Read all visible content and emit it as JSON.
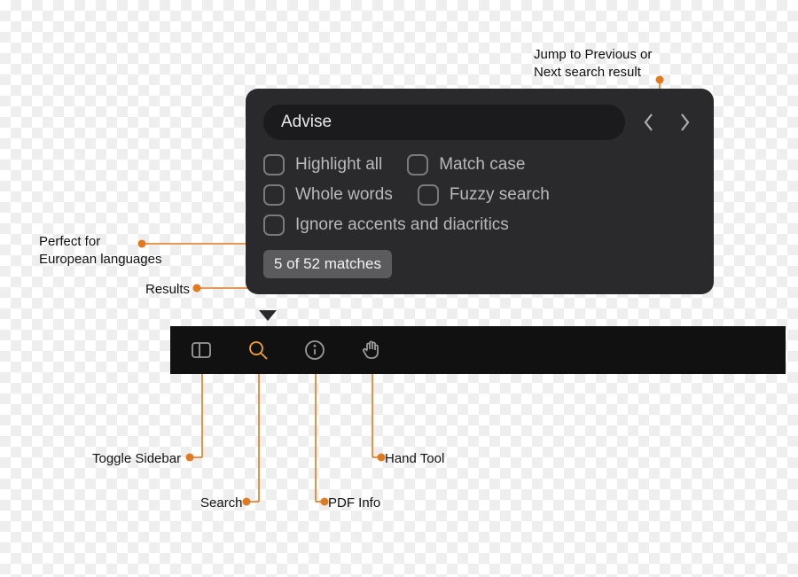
{
  "annotations": {
    "jump_prev_next": "Jump to Previous or\nNext search result",
    "accents_note": "Perfect for\nEuropean languages",
    "results_label": "Results",
    "toggle_sidebar": "Toggle Sidebar",
    "search": "Search",
    "pdf_info": "PDF Info",
    "hand_tool": "Hand Tool"
  },
  "popover": {
    "search_value": "Advise",
    "options": {
      "highlight_all": "Highlight all",
      "match_case": "Match case",
      "whole_words": "Whole words",
      "fuzzy_search": "Fuzzy search",
      "ignore_accents": "Ignore accents and diacritics"
    },
    "result_text": "5 of 52 matches"
  },
  "toolbar": {
    "items": [
      {
        "name": "sidebar-icon"
      },
      {
        "name": "search-icon"
      },
      {
        "name": "info-icon"
      },
      {
        "name": "hand-icon"
      }
    ]
  }
}
